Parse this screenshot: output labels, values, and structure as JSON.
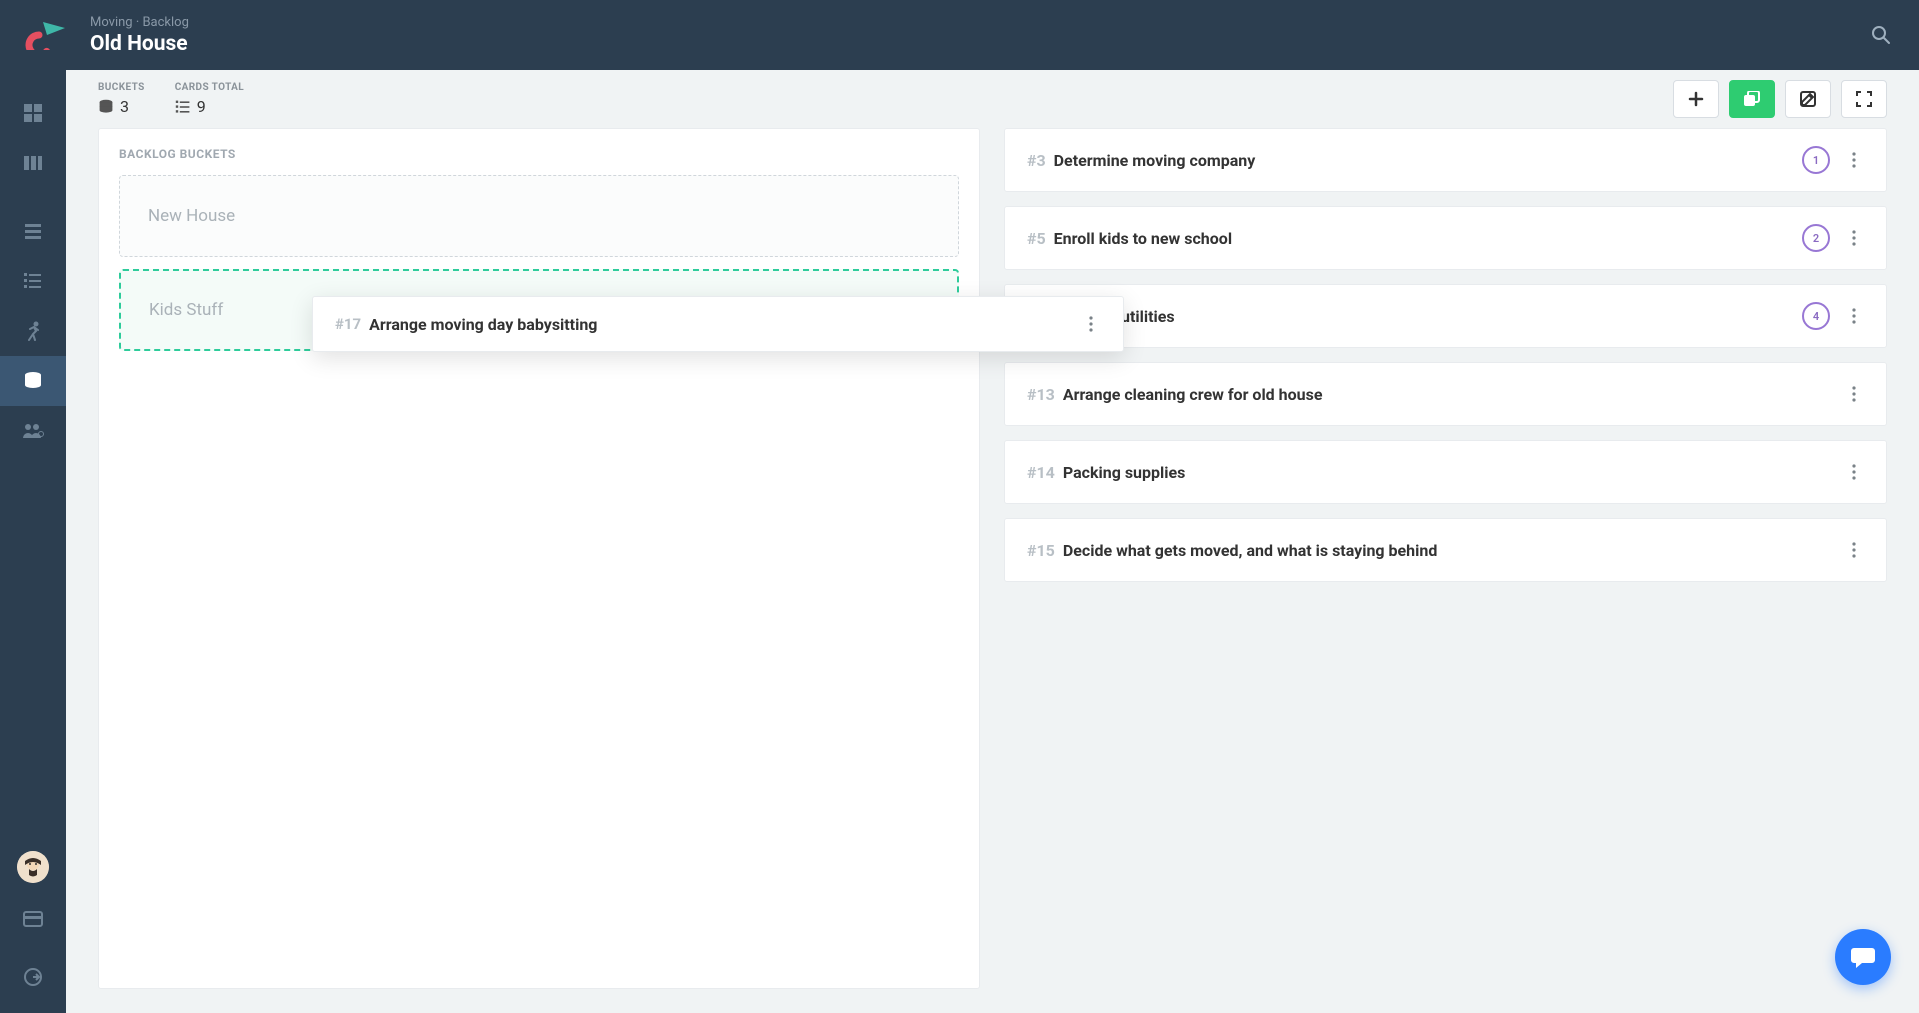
{
  "header": {
    "breadcrumb": "Moving · Backlog",
    "title": "Old House"
  },
  "stats": {
    "buckets_label": "BUCKETS",
    "buckets_value": "3",
    "cards_label": "CARDS TOTAL",
    "cards_value": "9"
  },
  "sections": {
    "buckets_title": "BACKLOG BUCKETS"
  },
  "buckets": [
    {
      "name": "New House"
    },
    {
      "name": "Kids Stuff"
    }
  ],
  "dragging_card": {
    "num": "#17",
    "title": "Arrange moving day babysitting"
  },
  "cards": [
    {
      "num": "#3",
      "title": "Determine moving company",
      "badge": "1"
    },
    {
      "num": "#5",
      "title": "Enroll kids to new school",
      "badge": "2"
    },
    {
      "num": "",
      "title": "utilities",
      "badge": "4",
      "partial": true
    },
    {
      "num": "#13",
      "title": "Arrange cleaning crew for old house",
      "badge": null
    },
    {
      "num": "#14",
      "title": "Packing supplies",
      "badge": null
    },
    {
      "num": "#15",
      "title": "Decide what gets moved, and what is staying behind",
      "badge": null
    }
  ]
}
